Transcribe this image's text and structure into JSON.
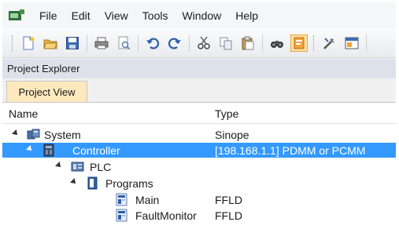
{
  "menu": [
    "File",
    "Edit",
    "View",
    "Tools",
    "Window",
    "Help"
  ],
  "toolbar": {
    "icons": [
      "new-icon",
      "open-icon",
      "save-icon",
      "print-icon",
      "print-preview-icon",
      "undo-icon",
      "redo-icon",
      "cut-icon",
      "copy-icon",
      "paste-icon",
      "find-icon",
      "project-explorer-icon",
      "settings-icon",
      "window-icon"
    ]
  },
  "panel": {
    "title": "Project Explorer"
  },
  "tabs": {
    "project_view": "Project View"
  },
  "columns": {
    "name": "Name",
    "type": "Type"
  },
  "tree": [
    {
      "label": "System",
      "type": "Sinope",
      "level": 0,
      "icon": "system-icon"
    },
    {
      "label": "Controller",
      "type": "[198.168.1.1] PDMM or PCMM",
      "level": 1,
      "icon": "controller-icon",
      "selected": true
    },
    {
      "label": "PLC",
      "type": "",
      "level": 2,
      "icon": "plc-icon"
    },
    {
      "label": "Programs",
      "type": "",
      "level": 3,
      "icon": "programs-icon"
    },
    {
      "label": "Main",
      "type": "FFLD",
      "level": 4,
      "icon": "program-icon"
    },
    {
      "label": "FaultMonitor",
      "type": "FFLD",
      "level": 4,
      "icon": "program-icon"
    }
  ],
  "colors": {
    "selection": "#3399ff",
    "tab_active": "#fde9bd",
    "panel_title": "#dde2ea"
  }
}
